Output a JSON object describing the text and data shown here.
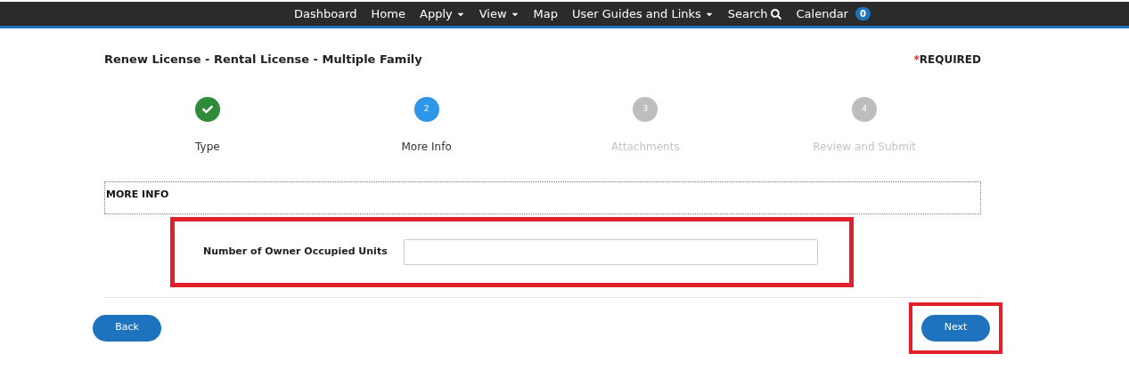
{
  "nav": [
    {
      "label": "Dashboard",
      "kind": "link"
    },
    {
      "label": "Home",
      "kind": "link"
    },
    {
      "label": "Apply",
      "kind": "dropdown"
    },
    {
      "label": "View",
      "kind": "dropdown"
    },
    {
      "label": "Map",
      "kind": "link"
    },
    {
      "label": "User Guides and Links",
      "kind": "dropdown"
    },
    {
      "label": "Search",
      "kind": "search"
    },
    {
      "label": "Calendar",
      "kind": "badge",
      "badge": "0"
    }
  ],
  "page_title": "Renew License - Rental License - Multiple Family",
  "required": {
    "mark": "*",
    "label": "REQUIRED"
  },
  "steps": [
    {
      "label": "Type",
      "kind": "complete"
    },
    {
      "number": "2",
      "label": "More Info",
      "kind": "current"
    },
    {
      "number": "3",
      "label": "Attachments",
      "kind": "upcoming"
    },
    {
      "number": "4",
      "label": "Review and Submit",
      "kind": "upcoming"
    }
  ],
  "section_title": "MORE INFO",
  "field": {
    "label": "Number of Owner Occupied Units",
    "highlighted": true
  },
  "buttons": [
    {
      "label": "Back",
      "highlighted": false
    },
    {
      "label": "Next",
      "highlighted": true
    }
  ]
}
